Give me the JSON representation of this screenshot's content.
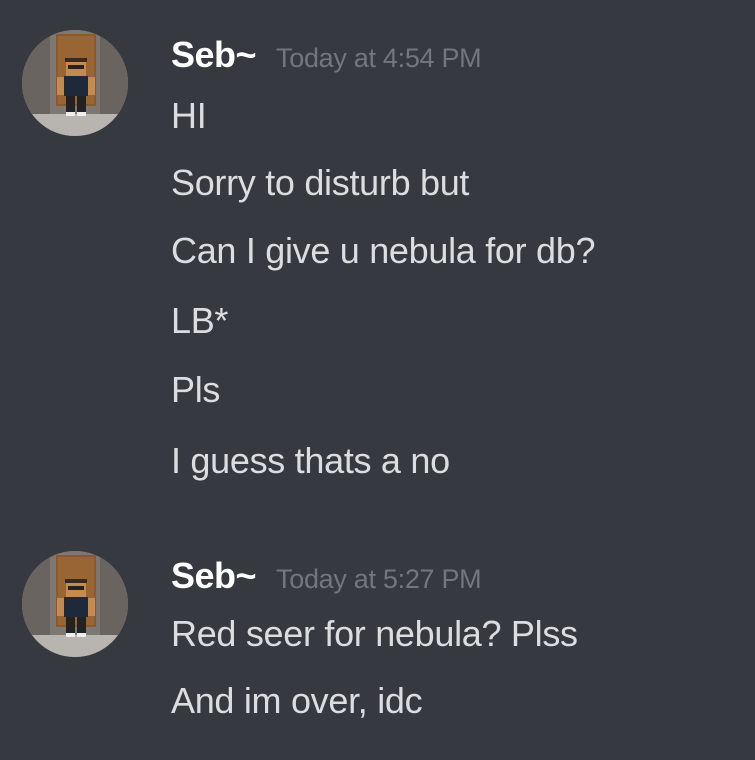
{
  "groups": [
    {
      "username": "Seb~",
      "timestamp": "Today at 4:54 PM",
      "messages": [
        "HI",
        "Sorry to disturb but",
        "Can I give u nebula for db?",
        "LB*",
        "Pls",
        "I guess thats a no"
      ]
    },
    {
      "username": "Seb~",
      "timestamp": "Today at 5:27 PM",
      "messages": [
        "Red seer for nebula? Plss",
        "And im over, idc"
      ]
    }
  ],
  "colors": {
    "background": "#36393f",
    "username": "#ffffff",
    "timestamp": "#72767d",
    "message_text": "#dcddde"
  },
  "icons": {
    "avatar": "roblox-avatar-icon"
  }
}
